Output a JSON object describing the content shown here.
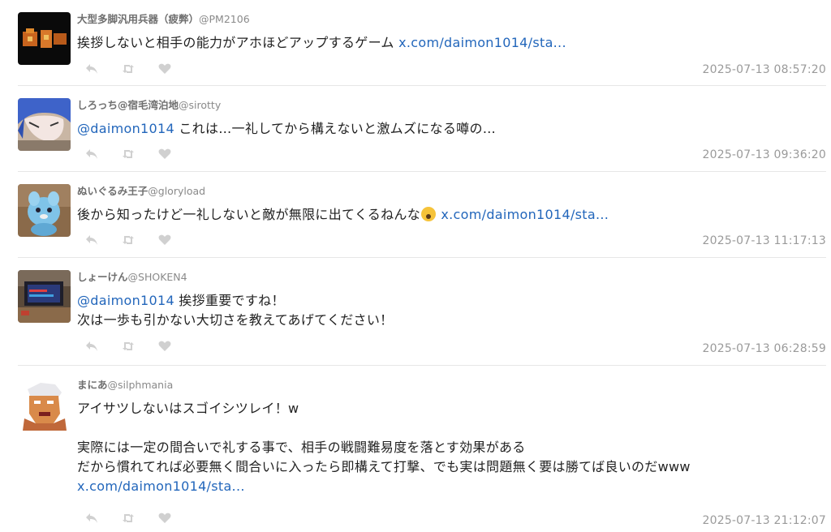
{
  "tweets": [
    {
      "display_name": "大型多脚汎用兵器（疲弊）",
      "handle": "@PM2106",
      "mention": "",
      "text": "挨拶しないと相手の能力がアホほどアップするゲーム ",
      "link": "x.com/daimon1014/sta...",
      "timestamp": "2025-07-13 08:57:20",
      "avatar_icon": "orange-pixel-avatar"
    },
    {
      "display_name": "しろっち@宿毛湾泊地",
      "handle": "@sirotty",
      "mention": "@daimon1014",
      "text": " これは…一礼してから構えないと激ムズになる噂の…",
      "link": "",
      "timestamp": "2025-07-13 09:36:20",
      "avatar_icon": "blue-hair-anime-avatar"
    },
    {
      "display_name": "ぬいぐるみ王子",
      "handle": "@gloryload",
      "mention": "",
      "text": "後から知ったけど一礼しないと敵が無限に出てくるねんな",
      "emoji": "scream-emoji",
      "link": "x.com/daimon1014/sta...",
      "timestamp": "2025-07-13 11:17:13",
      "avatar_icon": "plush-toy-avatar"
    },
    {
      "display_name": "しょーけん",
      "handle": "@SHOKEN4",
      "mention": "@daimon1014",
      "text": " 挨拶重要ですね！",
      "text2": "次は一歩も引かない大切さを教えてあげてください！",
      "timestamp": "2025-07-13 06:28:59",
      "avatar_icon": "retro-tv-avatar"
    },
    {
      "display_name": "まにあ",
      "handle": "@silphmania",
      "text": "アイサツしないはスゴイシツレイ！w",
      "text2": "実際には一定の間合いで礼する事で、相手の戦闘難易度を落とす効果がある",
      "text3": "だから慣れてれば必要無く間合いに入ったら即構えて打撃、でも実は問題無く要は勝てば良いのだwww",
      "link": "x.com/daimon1014/sta...",
      "timestamp": "2025-07-13 21:12:07",
      "avatar_icon": "pixel-fighter-avatar"
    }
  ],
  "actions": {
    "reply_icon": "reply-icon",
    "retweet_icon": "retweet-icon",
    "like_icon": "heart-icon"
  },
  "colors": {
    "link": "#2266bb",
    "muted": "#9a9a9a",
    "icon": "#d0d0d0"
  }
}
